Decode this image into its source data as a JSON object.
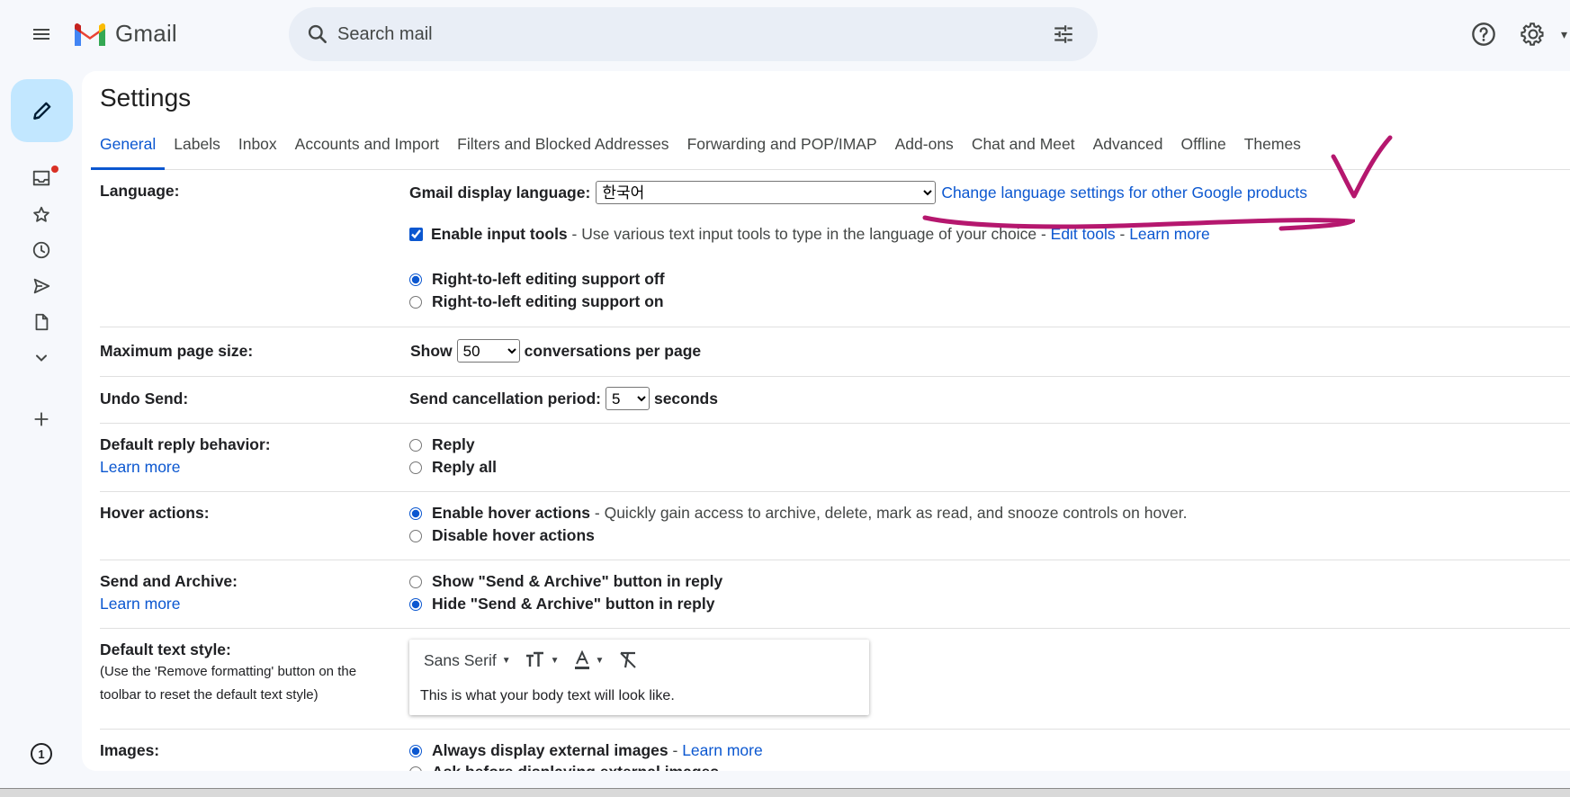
{
  "header": {
    "app_name": "Gmail",
    "search_placeholder": "Search mail"
  },
  "settings": {
    "title": "Settings",
    "tabs": [
      "General",
      "Labels",
      "Inbox",
      "Accounts and Import",
      "Filters and Blocked Addresses",
      "Forwarding and POP/IMAP",
      "Add-ons",
      "Chat and Meet",
      "Advanced",
      "Offline",
      "Themes"
    ],
    "active_tab": "General"
  },
  "language": {
    "label": "Language:",
    "display_label": "Gmail display language:",
    "selected": "한국어",
    "other_products_link": "Change language settings for other Google products",
    "input_tools_label": "Enable input tools",
    "input_tools_desc": " - Use various text input tools to type in the language of your choice - ",
    "edit_tools": "Edit tools",
    "sep": " - ",
    "learn_more": "Learn more",
    "rtl_off": "Right-to-left editing support off",
    "rtl_on": "Right-to-left editing support on"
  },
  "page_size": {
    "label": "Maximum page size:",
    "show": "Show",
    "value": "50",
    "suffix": "conversations per page"
  },
  "undo_send": {
    "label": "Undo Send:",
    "prefix": "Send cancellation period:",
    "value": "5",
    "suffix": "seconds"
  },
  "reply": {
    "label": "Default reply behavior:",
    "learn_more": "Learn more",
    "opt1": "Reply",
    "opt2": "Reply all"
  },
  "hover": {
    "label": "Hover actions:",
    "enable": "Enable hover actions",
    "enable_desc": " - Quickly gain access to archive, delete, mark as read, and snooze controls on hover.",
    "disable": "Disable hover actions"
  },
  "send_archive": {
    "label": "Send and Archive:",
    "learn_more": "Learn more",
    "show": "Show \"Send & Archive\" button in reply",
    "hide": "Hide \"Send & Archive\" button in reply"
  },
  "text_style": {
    "label": "Default text style:",
    "note": "(Use the 'Remove formatting' button on the toolbar to reset the default text style)",
    "font": "Sans Serif",
    "sample": "This is what your body text will look like."
  },
  "images": {
    "label": "Images:",
    "always": "Always display external images",
    "sep": " - ",
    "learn_more": "Learn more",
    "ask": "Ask before displaying external images"
  },
  "rail": {
    "badge": "1"
  },
  "annotation": {
    "ink_color": "#b5176e"
  }
}
